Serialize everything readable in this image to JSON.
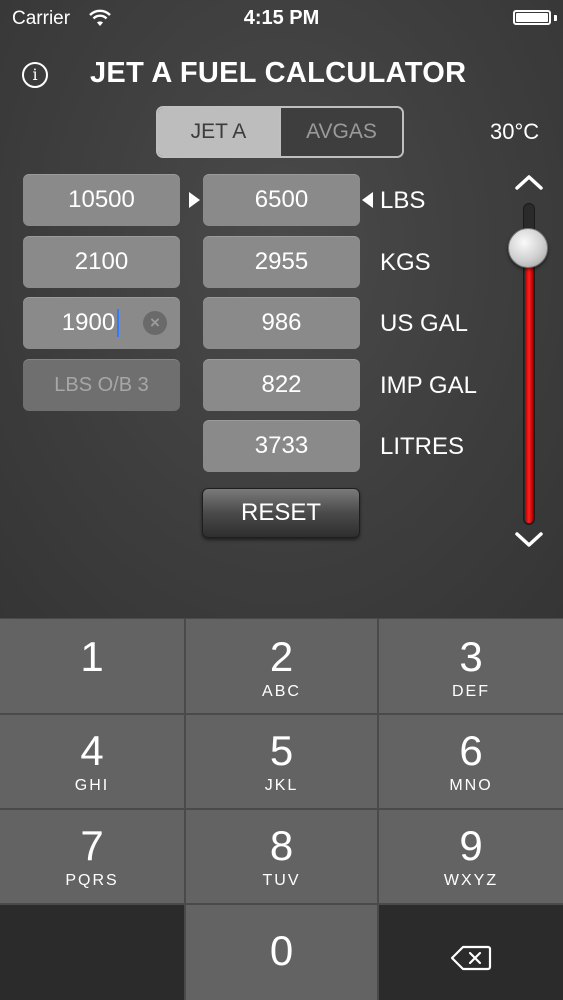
{
  "status_bar": {
    "carrier": "Carrier",
    "time": "4:15 PM"
  },
  "header": {
    "title": "JET A FUEL CALCULATOR"
  },
  "fuel_type": {
    "options": [
      "JET A",
      "AVGAS"
    ],
    "selected": "JET A"
  },
  "temperature": {
    "label": "30°C",
    "slider_level": 0.86
  },
  "inputs": {
    "left_column": [
      "10500",
      "2100",
      "1900"
    ],
    "left_placeholder": "LBS O/B 3"
  },
  "conversions": [
    {
      "value": "6500",
      "unit": "LBS"
    },
    {
      "value": "2955",
      "unit": "KGS"
    },
    {
      "value": "986",
      "unit": "US GAL"
    },
    {
      "value": "822",
      "unit": "IMP GAL"
    },
    {
      "value": "3733",
      "unit": "LITRES"
    }
  ],
  "reset_label": "RESET",
  "keypad": [
    {
      "digit": "1",
      "letters": ""
    },
    {
      "digit": "2",
      "letters": "ABC"
    },
    {
      "digit": "3",
      "letters": "DEF"
    },
    {
      "digit": "4",
      "letters": "GHI"
    },
    {
      "digit": "5",
      "letters": "JKL"
    },
    {
      "digit": "6",
      "letters": "MNO"
    },
    {
      "digit": "7",
      "letters": "PQRS"
    },
    {
      "digit": "8",
      "letters": "TUV"
    },
    {
      "digit": "9",
      "letters": "WXYZ"
    },
    {
      "digit": "0",
      "letters": ""
    }
  ],
  "icons": {
    "info": "info-icon",
    "wifi": "wifi-icon",
    "battery": "battery-icon",
    "clear": "clear-icon",
    "up": "chevron-up-icon",
    "down": "chevron-down-icon",
    "backspace": "backspace-icon"
  },
  "colors": {
    "slider_fill": "#ff2020",
    "cursor": "#2f7bff"
  }
}
